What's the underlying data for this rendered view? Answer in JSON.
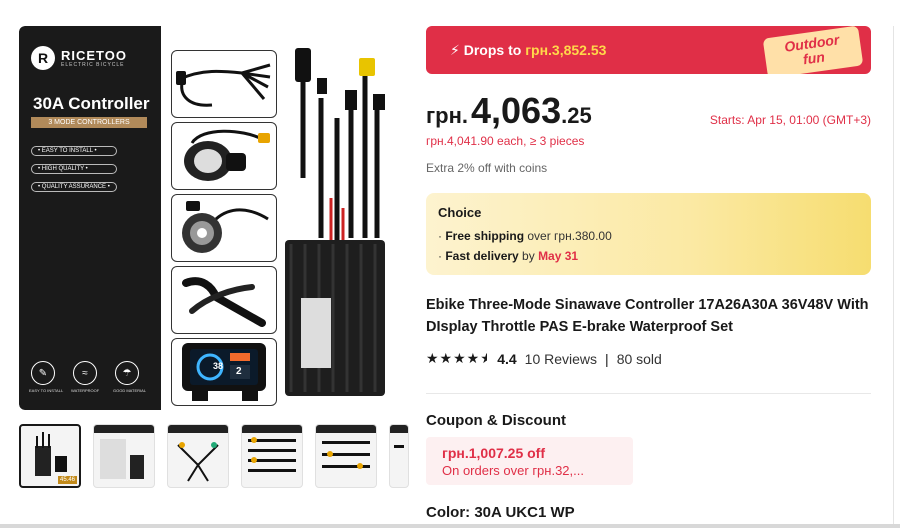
{
  "gallery": {
    "brand": {
      "logo_letter": "R",
      "name": "RICETOO",
      "subtitle": "ELECTRIC BICYCLE"
    },
    "headline": "30A Controller",
    "mode_label": "3 MODE CONTROLLERS",
    "features": [
      "EASY TO INSTALL",
      "HIGH QUALITY",
      "QUALITY ASSURANCE"
    ],
    "badges": [
      {
        "icon": "wrench-icon",
        "label": "EASY TO INSTALL"
      },
      {
        "icon": "waterproof-icon",
        "label": "WATERPROOF"
      },
      {
        "icon": "umbrella-icon",
        "label": "GOOD MATERIAL"
      }
    ],
    "display_speed": "38",
    "display_level": "2",
    "thumbnail_count": 7,
    "thumbnail_label": "45.46"
  },
  "promo": {
    "icon": "lightning-icon",
    "prefix": "Drops to",
    "price": "грн.3,852.53",
    "tag_line1": "Outdoor",
    "tag_line2": "fun"
  },
  "price": {
    "currency": "грн.",
    "main": "4,063",
    "cents": ".25",
    "bulk": "грн.4,041.90 each, ≥ 3 pieces",
    "starts": "Starts:  Apr 15, 01:00 (GMT+3)",
    "coins": "Extra 2% off with coins"
  },
  "choice": {
    "title": "Choice",
    "shipping_bold": "Free shipping",
    "shipping_rest": " over грн.380.00",
    "delivery_bold": "Fast delivery",
    "delivery_by": " by ",
    "delivery_date": "May 31"
  },
  "product": {
    "title": "Ebike Three-Mode Sinawave Controller 17A26A30A 36V48V With DIsplay Throttle PAS E-brake Waterproof Set",
    "rating": "4.4",
    "stars": 4.4,
    "reviews": "10 Reviews",
    "sold": "80 sold"
  },
  "coupon": {
    "heading": "Coupon & Discount",
    "amount": "грн.1,007.25 off",
    "condition": "On orders over грн.32,..."
  },
  "color": {
    "label": "Color: 30A UKC1 WP"
  },
  "colors": {
    "accent_red": "#e02f47",
    "promo_yellow": "#ffd84a",
    "choice_bg": "#fbe9a3"
  }
}
